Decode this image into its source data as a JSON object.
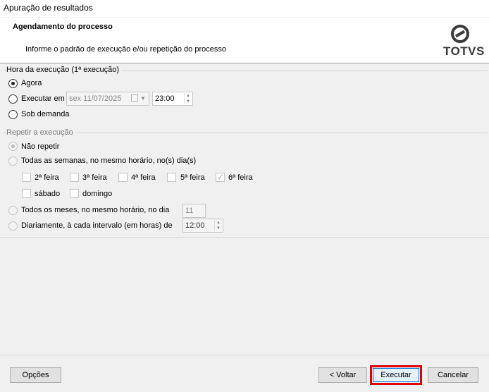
{
  "window": {
    "title": "Apuração de resultados"
  },
  "header": {
    "title": "Agendamento do processo",
    "subtitle": "Informe o padrão de execução e/ou repetição do processo",
    "logo_text": "TOTVS"
  },
  "execution": {
    "group_title": "Hora da execução (1ª execução)",
    "option_now": "Agora",
    "option_schedule": "Executar em",
    "option_on_demand": "Sob demanda",
    "selected": "Agora",
    "date_value": "sex  11/07/2025",
    "time_value": "23:00"
  },
  "repeat": {
    "group_title": "Repetir a execução",
    "option_no_repeat": "Não repetir",
    "option_weekly": "Todas as semanas, no mesmo horário, no(s) dia(s)",
    "days": [
      {
        "label": "2ª feira",
        "checked": false
      },
      {
        "label": "3ª feira",
        "checked": false
      },
      {
        "label": "4ª feira",
        "checked": false
      },
      {
        "label": "5ª feira",
        "checked": false
      },
      {
        "label": "6ª feira",
        "checked": true
      },
      {
        "label": "sábado",
        "checked": false
      },
      {
        "label": "domingo",
        "checked": false
      }
    ],
    "option_monthly": "Todos os meses, no mesmo horário, no dia",
    "monthly_day": "11",
    "option_interval": "Diariamente, à cada intervalo (em horas) de",
    "interval_value": "12:00",
    "selected": "Não repetir"
  },
  "footer": {
    "options_label": "Opções",
    "back_label": "< Voltar",
    "execute_label": "Executar",
    "cancel_label": "Cancelar"
  }
}
